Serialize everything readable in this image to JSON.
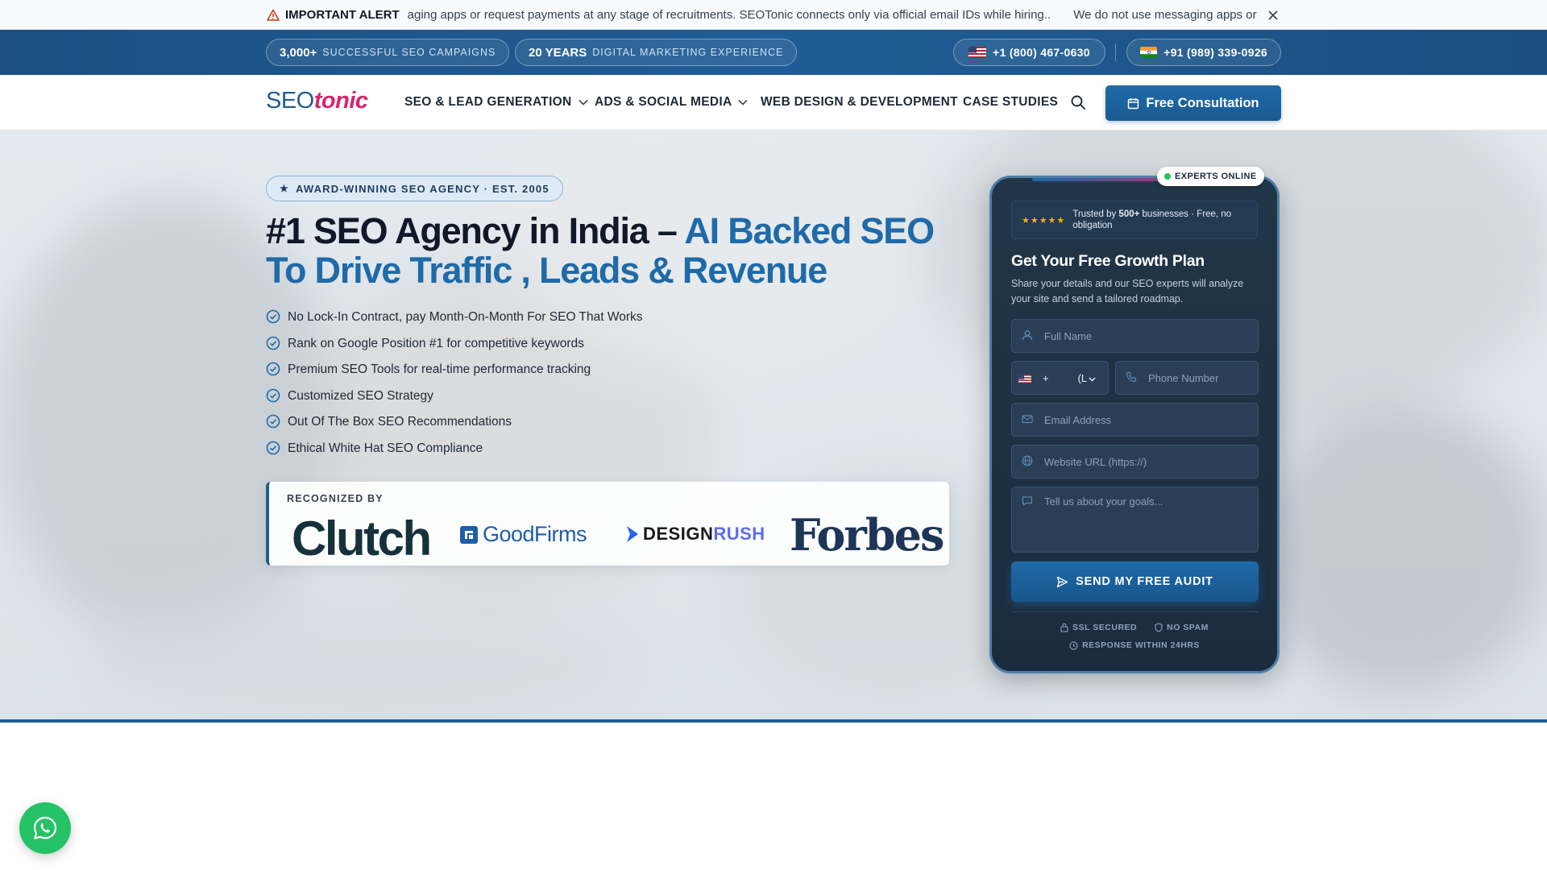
{
  "alert": {
    "title": "IMPORTANT ALERT",
    "ticker_1": "aging apps or request payments at any stage of recruitments. SEOTonic connects only via official email IDs while hiring..",
    "ticker_2": "We do not use messaging apps or r"
  },
  "stats": {
    "campaigns_num": "3,000+",
    "campaigns_label": "SUCCESSFUL SEO CAMPAIGNS",
    "years_num": "20 YEARS",
    "years_label": "DIGITAL MARKETING EXPERIENCE",
    "phone_us": "+1 (800) 467-0630",
    "phone_in": "+91 (989) 339-0926"
  },
  "nav": {
    "logo_seo": "SEO",
    "logo_tonic": "tonic",
    "items": [
      {
        "label": "SEO & LEAD GENERATION"
      },
      {
        "label": "ADS & SOCIAL MEDIA"
      },
      {
        "label": "WEB DESIGN & DEVELOPMENT"
      },
      {
        "label": "CASE STUDIES"
      }
    ],
    "cta": "Free Consultation"
  },
  "hero": {
    "badge": "AWARD-WINNING SEO AGENCY  ·  EST. 2005",
    "title_main": "#1 SEO Agency in India – ",
    "title_accent": "AI Backed SEO To Drive Traffic , Leads & Revenue",
    "bullets": [
      "No Lock-In Contract, pay Month-On-Month For SEO That Works",
      "Rank on Google Position #1 for competitive keywords",
      "Premium SEO Tools for real-time performance tracking",
      "Customized SEO Strategy",
      "Out Of The Box SEO Recommendations",
      "Ethical White Hat SEO Compliance"
    ],
    "recognized_label": "RECOGNIZED BY",
    "logos": {
      "clutch": "Clutch",
      "goodfirms": "GoodFirms",
      "designrush_a": "DESIGN",
      "designrush_b": "RUSH",
      "forbes": "Forbes"
    }
  },
  "form": {
    "online": "EXPERTS ONLINE",
    "stars": "★★★★★",
    "trust_prefix": "Trusted by ",
    "trust_bold": "500+",
    "trust_suffix": " businesses · Free, no obligation",
    "title": "Get Your Free Growth Plan",
    "subtitle": "Share your details and our SEO experts will analyze your site and send a tailored roadmap.",
    "name_placeholder": "Full Name",
    "cc_plus": "+",
    "cc_unit": "(L",
    "phone_placeholder": "Phone Number",
    "email_placeholder": "Email Address",
    "url_placeholder": "Website URL (https://)",
    "goals_placeholder": "Tell us about your goals...",
    "submit": "SEND MY FREE AUDIT",
    "ssl": "SSL SECURED",
    "nospam": "NO SPAM",
    "response": "RESPONSE WITHIN 24HRS"
  },
  "colors": {
    "brand_blue": "#1f5d96",
    "brand_pink": "#d6246e",
    "whatsapp": "#25c266"
  }
}
